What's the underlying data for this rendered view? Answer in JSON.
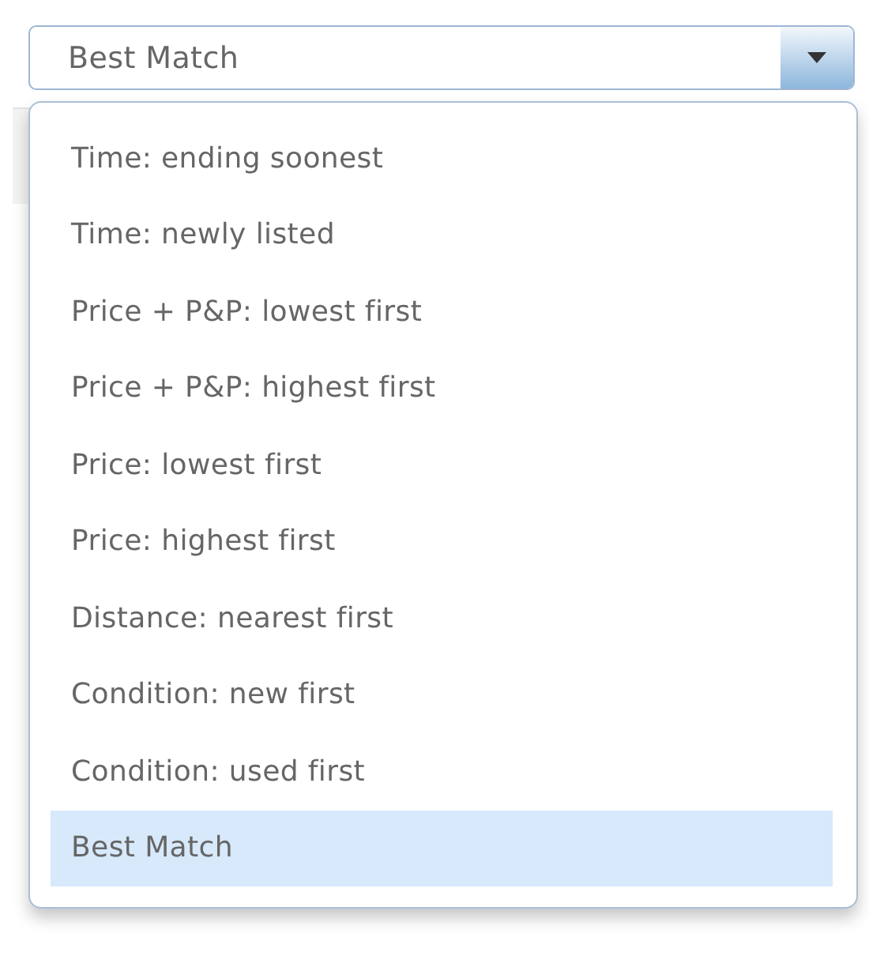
{
  "select": {
    "value": "Best Match"
  },
  "options": [
    {
      "label": "Time: ending soonest",
      "selected": false
    },
    {
      "label": "Time: newly listed",
      "selected": false
    },
    {
      "label": "Price + P&P: lowest first",
      "selected": false
    },
    {
      "label": "Price + P&P: highest first",
      "selected": false
    },
    {
      "label": "Price: lowest first",
      "selected": false
    },
    {
      "label": "Price: highest first",
      "selected": false
    },
    {
      "label": "Distance: nearest first",
      "selected": false
    },
    {
      "label": "Condition: new first",
      "selected": false
    },
    {
      "label": "Condition: used first",
      "selected": false
    },
    {
      "label": "Best Match",
      "selected": true
    }
  ]
}
